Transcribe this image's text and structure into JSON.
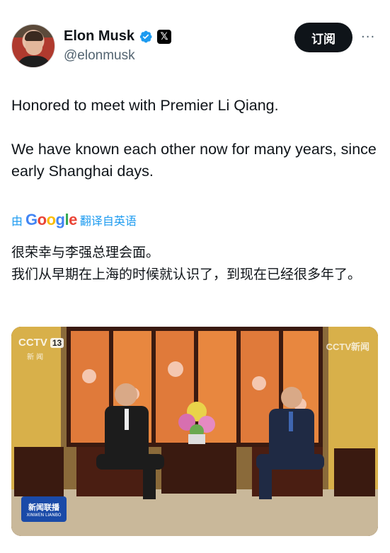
{
  "user": {
    "name": "Elon Musk",
    "handle": "@elonmusk",
    "verified_icon": "verified-badge-icon",
    "affiliation_icon": "x-logo-icon",
    "affiliation_text": "𝕏"
  },
  "actions": {
    "subscribe_label": "订阅",
    "more_label": "···"
  },
  "tweet": {
    "paragraphs": [
      "Honored to meet with Premier Li Qiang.",
      "We have known each other now for many years, since early Shanghai days."
    ]
  },
  "translation": {
    "prefix": "由",
    "provider": "Google",
    "suffix": "翻译自英语",
    "lines": [
      "很荣幸与李强总理会面。",
      "我们从早期在上海的时候就认识了，到现在已经很多年了。"
    ]
  },
  "media": {
    "overlay_logo_left": "CCTV",
    "overlay_channel": "13",
    "overlay_sub": "新 闻",
    "overlay_logo_right": "CCTV新闻",
    "overlay_bottom": "新闻联播",
    "overlay_bottom_en": "XINWEN LIANBO"
  },
  "colors": {
    "accent": "#1d9bf0",
    "text": "#0f1419",
    "secondary": "#536471",
    "button": "#0f1419"
  }
}
